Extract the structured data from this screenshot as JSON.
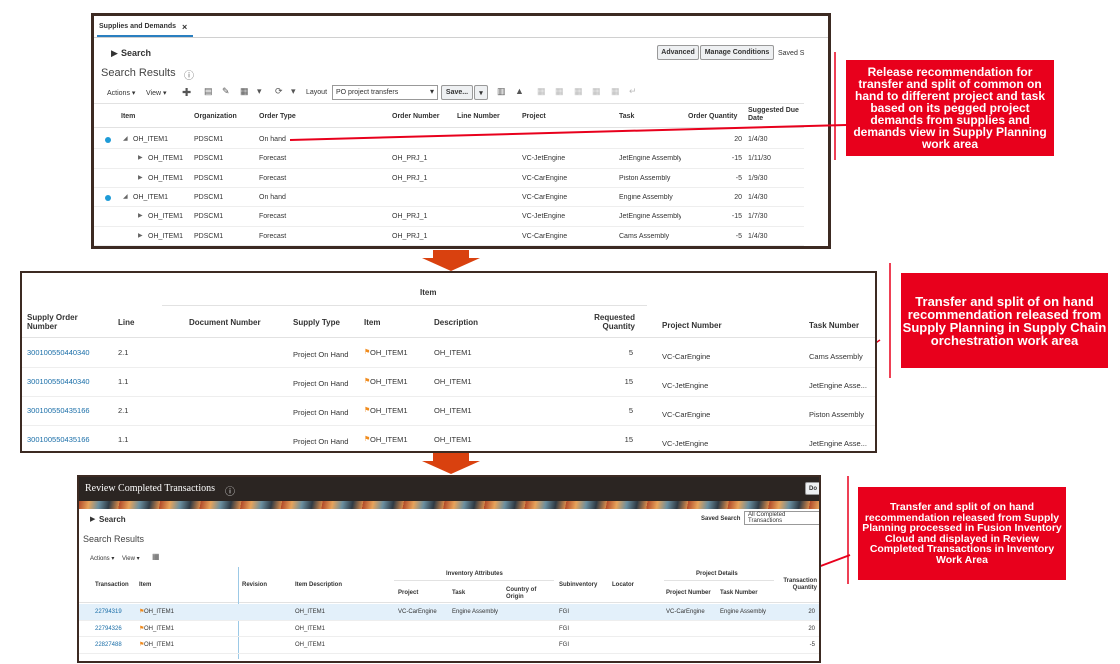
{
  "panel1": {
    "tab_label": "Supplies and Demands",
    "close_glyph": "×",
    "search_label": "Search",
    "advanced_label": "Advanced",
    "manage_label": "Manage Conditions",
    "saved_label": "Saved S",
    "results_title": "Search Results",
    "actions_label": "Actions ▾",
    "view_label": "View ▾",
    "layout_label": "Layout",
    "layout_value": "PO project transfers",
    "save_label": "Save...",
    "columns": [
      "Item",
      "Organization",
      "Order Type",
      "Order Number",
      "Line Number",
      "Project",
      "Task",
      "Order Quantity",
      "Suggested Due Date"
    ],
    "rows": [
      {
        "item": "OH_ITEM1",
        "org": "PDSCM1",
        "type": "On hand",
        "order": "",
        "line": "",
        "project": "",
        "task": "",
        "qty": "20",
        "due": "1/4/30"
      },
      {
        "item": "OH_ITEM1",
        "org": "PDSCM1",
        "type": "Forecast",
        "order": "OH_PRJ_1",
        "line": "",
        "project": "VC-JetEngine",
        "task": "JetEngine Assembly",
        "qty": "-15",
        "due": "1/11/30"
      },
      {
        "item": "OH_ITEM1",
        "org": "PDSCM1",
        "type": "Forecast",
        "order": "OH_PRJ_1",
        "line": "",
        "project": "VC-CarEngine",
        "task": "Piston Assembly",
        "qty": "-5",
        "due": "1/9/30"
      },
      {
        "item": "OH_ITEM1",
        "org": "PDSCM1",
        "type": "On hand",
        "order": "",
        "line": "",
        "project": "VC-CarEngine",
        "task": "Engine Assembly",
        "qty": "20",
        "due": "1/4/30"
      },
      {
        "item": "OH_ITEM1",
        "org": "PDSCM1",
        "type": "Forecast",
        "order": "OH_PRJ_1",
        "line": "",
        "project": "VC-JetEngine",
        "task": "JetEngine Assembly",
        "qty": "-15",
        "due": "1/7/30"
      },
      {
        "item": "OH_ITEM1",
        "org": "PDSCM1",
        "type": "Forecast",
        "order": "OH_PRJ_1",
        "line": "",
        "project": "VC-CarEngine",
        "task": "Cams Assembly",
        "qty": "-5",
        "due": "1/4/30"
      }
    ]
  },
  "panel2": {
    "group_header": "Item",
    "columns": [
      "Supply Order Number",
      "Line",
      "Document Number",
      "Supply Type",
      "Item",
      "Description",
      "Requested Quantity",
      "Project Number",
      "Task Number"
    ],
    "rows": [
      {
        "order": "300100550440340",
        "line": "2.1",
        "doc": "",
        "type": "Project On Hand",
        "item": "OH_ITEM1",
        "desc": "OH_ITEM1",
        "qty": "5",
        "project": "VC-CarEngine",
        "task": "Cams Assembly"
      },
      {
        "order": "300100550440340",
        "line": "1.1",
        "doc": "",
        "type": "Project On Hand",
        "item": "OH_ITEM1",
        "desc": "OH_ITEM1",
        "qty": "15",
        "project": "VC-JetEngine",
        "task": "JetEngine Asse..."
      },
      {
        "order": "300100550435166",
        "line": "2.1",
        "doc": "",
        "type": "Project On Hand",
        "item": "OH_ITEM1",
        "desc": "OH_ITEM1",
        "qty": "5",
        "project": "VC-CarEngine",
        "task": "Piston Assembly"
      },
      {
        "order": "300100550435166",
        "line": "1.1",
        "doc": "",
        "type": "Project On Hand",
        "item": "OH_ITEM1",
        "desc": "OH_ITEM1",
        "qty": "15",
        "project": "VC-JetEngine",
        "task": "JetEngine Asse..."
      }
    ]
  },
  "panel3": {
    "title": "Review Completed Transactions",
    "done_label": "Do",
    "search_label": "Search",
    "saved_search_label": "Saved Search",
    "saved_search_value": "All Completed Transactions",
    "results_title": "Search Results",
    "actions_label": "Actions ▾",
    "view_label": "View ▾",
    "inventory_group": "Inventory Attributes",
    "project_group": "Project Details",
    "columns": [
      "Transaction",
      "Item",
      "Revision",
      "Item Description",
      "Project",
      "Task",
      "Country of Origin",
      "Subinventory",
      "Locator",
      "Project Number",
      "Task Number",
      "Transaction Quantity"
    ],
    "rows": [
      {
        "txn": "22794319",
        "item": "OH_ITEM1",
        "rev": "",
        "desc": "OH_ITEM1",
        "project": "VC-CarEngine",
        "task": "Engine Assembly",
        "country": "",
        "subinv": "FGI",
        "locator": "",
        "proj_num": "VC-CarEngine",
        "task_num": "Engine Assembly",
        "qty": "20"
      },
      {
        "txn": "22794326",
        "item": "OH_ITEM1",
        "rev": "",
        "desc": "OH_ITEM1",
        "project": "",
        "task": "",
        "country": "",
        "subinv": "FGI",
        "locator": "",
        "proj_num": "",
        "task_num": "",
        "qty": "20"
      },
      {
        "txn": "22827488",
        "item": "OH_ITEM1",
        "rev": "",
        "desc": "OH_ITEM1",
        "project": "",
        "task": "",
        "country": "",
        "subinv": "FGI",
        "locator": "",
        "proj_num": "",
        "task_num": "",
        "qty": "-5"
      }
    ]
  },
  "callouts": {
    "c1": "Release recommendation for transfer and split of common on hand  to different project and task based on its pegged project demands from supplies and demands view in Supply Planning work area",
    "c2": "Transfer and split of on hand recommendation released from Supply Planning in Supply Chain orchestration work area",
    "c3": "Transfer and split of on hand recommendation released from Supply Planning  processed in Fusion Inventory Cloud and displayed in Review Completed Transactions in Inventory Work Area"
  },
  "colors": {
    "frame": "#3c2a22",
    "callout": "#e8001c",
    "arrow": "#d9410f",
    "link": "#1a6ea8",
    "selected_row": "#e3f0fa"
  }
}
